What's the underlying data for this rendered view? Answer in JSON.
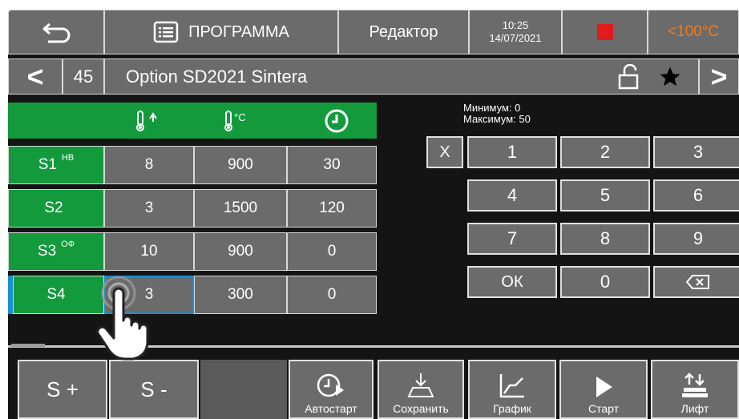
{
  "header": {
    "title": "ПРОГРАММА",
    "mode": "Редактор",
    "time": "10:25",
    "date": "14/07/2021",
    "temp_status": "<100°C",
    "temp_color": "#f07c1a",
    "stop_color": "#e01b1b"
  },
  "program": {
    "number": "45",
    "name": "Option SD2021 Sintera",
    "prev_glyph": "<",
    "next_glyph": ">"
  },
  "table": {
    "column_icons": [
      "thermometer-up-icon",
      "thermometer-celsius-icon",
      "clock-icon"
    ],
    "celsius_label": "°C",
    "rows": [
      {
        "label": "S1",
        "tag": "НВ",
        "values": [
          "8",
          "900",
          "30"
        ]
      },
      {
        "label": "S2",
        "tag": "",
        "values": [
          "3",
          "1500",
          "120"
        ]
      },
      {
        "label": "S3",
        "tag": "ОФ",
        "values": [
          "10",
          "900",
          "0"
        ]
      },
      {
        "label": "S4",
        "tag": "",
        "values": [
          "3",
          "300",
          "0"
        ]
      }
    ]
  },
  "keypad": {
    "min_label": "Минимум: 0",
    "max_label": "Максимум: 50",
    "clear": "X",
    "keys": [
      "1",
      "2",
      "3",
      "4",
      "5",
      "6",
      "7",
      "8",
      "9",
      "ОК",
      "0"
    ]
  },
  "bottom": {
    "add_step": "S +",
    "remove_step": "S -",
    "autostart": "Автостарт",
    "save": "Сохранить",
    "graph": "График",
    "start": "Старт",
    "lift": "Лифт"
  },
  "colors": {
    "green": "#139a3d",
    "gray": "#6b6b6b",
    "selection": "#1a8fd8"
  }
}
